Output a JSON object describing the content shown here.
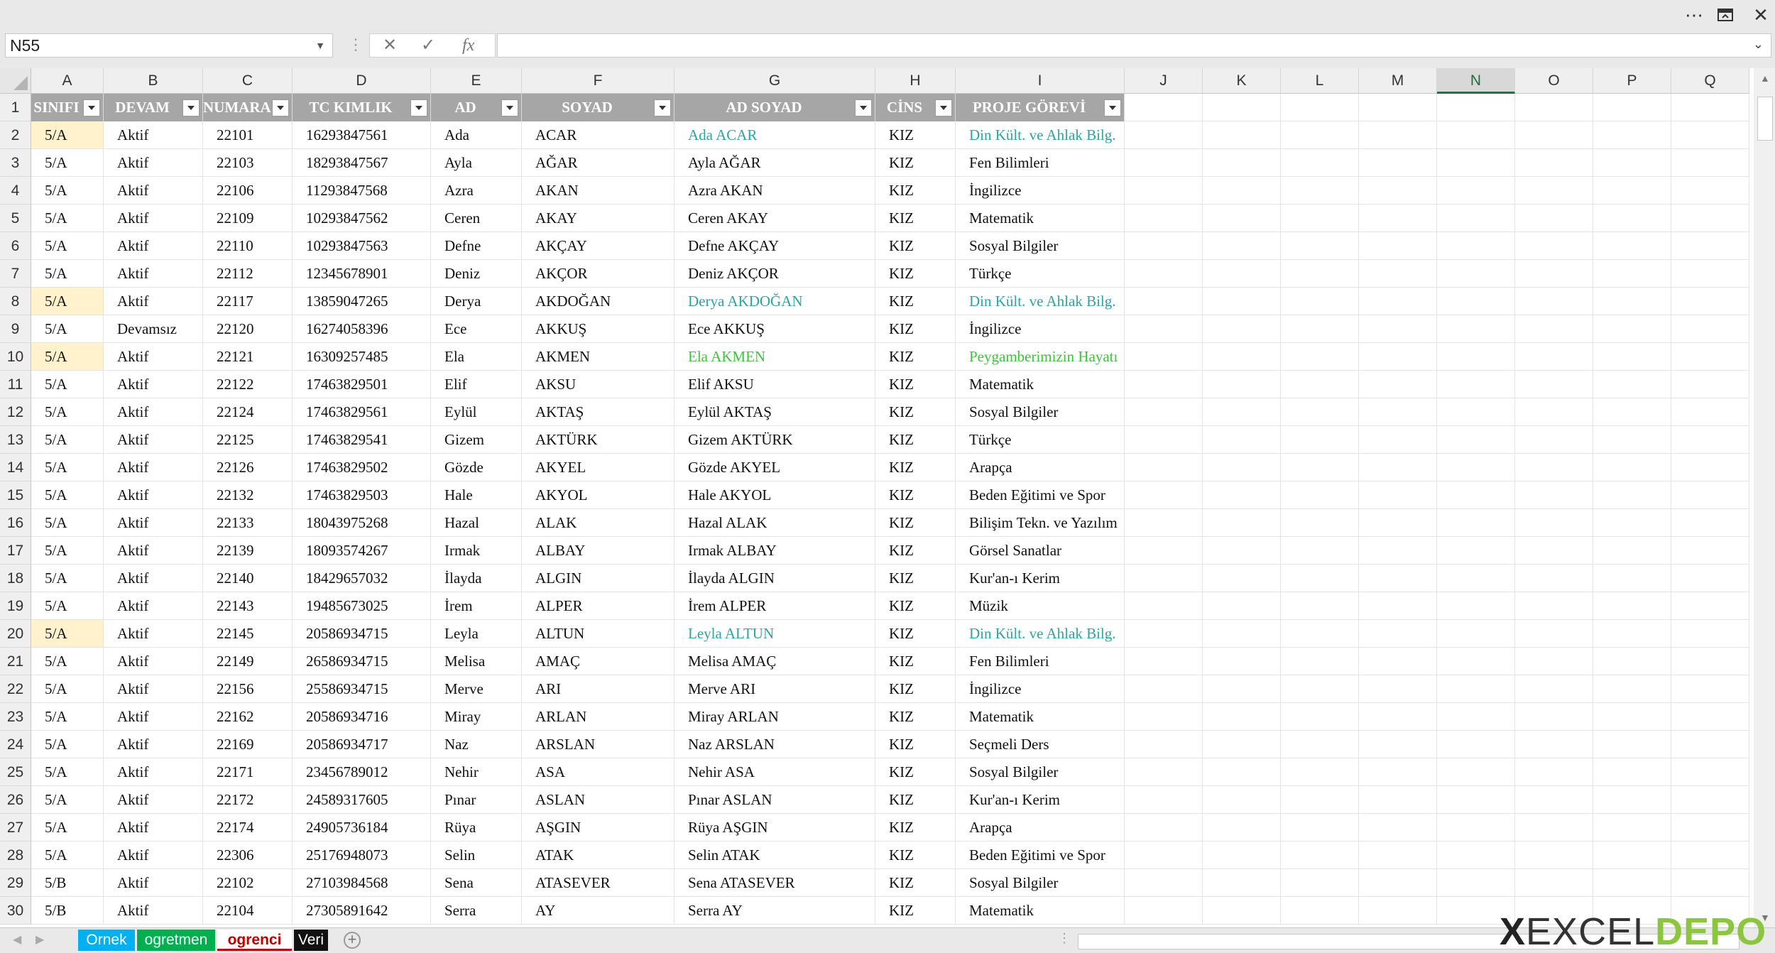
{
  "window": {
    "more_icon": "ellipsis-icon",
    "restore_icon": "restore-icon",
    "close_icon": "close-icon"
  },
  "formula_bar": {
    "name_box": "N55",
    "fx_label": "fx",
    "cancel_glyph": "✕",
    "enter_glyph": "✓",
    "formula": ""
  },
  "columns": [
    "A",
    "B",
    "C",
    "D",
    "E",
    "F",
    "G",
    "H",
    "I",
    "J",
    "K",
    "L",
    "M",
    "N",
    "O",
    "P",
    "Q"
  ],
  "selected_column": "N",
  "headers": [
    "SINIFI",
    "DEVAM",
    "NUMARA",
    "TC KIMLIK",
    "AD",
    "SOYAD",
    "AD SOYAD",
    "CİNS",
    "PROJE GÖREVİ"
  ],
  "rows": [
    [
      "5/A",
      "Aktif",
      "22101",
      "16293847561",
      "Ada",
      "ACAR",
      "Ada ACAR",
      "KIZ",
      "Din Kült. ve Ahlak Bilg."
    ],
    [
      "5/A",
      "Aktif",
      "22103",
      "18293847567",
      "Ayla",
      "AĞAR",
      "Ayla AĞAR",
      "KIZ",
      "Fen Bilimleri"
    ],
    [
      "5/A",
      "Aktif",
      "22106",
      "11293847568",
      "Azra",
      "AKAN",
      "Azra AKAN",
      "KIZ",
      "İngilizce"
    ],
    [
      "5/A",
      "Aktif",
      "22109",
      "10293847562",
      "Ceren",
      "AKAY",
      "Ceren AKAY",
      "KIZ",
      "Matematik"
    ],
    [
      "5/A",
      "Aktif",
      "22110",
      "10293847563",
      "Defne",
      "AKÇAY",
      "Defne AKÇAY",
      "KIZ",
      "Sosyal Bilgiler"
    ],
    [
      "5/A",
      "Aktif",
      "22112",
      "12345678901",
      "Deniz",
      "AKÇOR",
      "Deniz AKÇOR",
      "KIZ",
      "Türkçe"
    ],
    [
      "5/A",
      "Aktif",
      "22117",
      "13859047265",
      "Derya",
      "AKDOĞAN",
      "Derya AKDOĞAN",
      "KIZ",
      "Din Kült. ve Ahlak Bilg."
    ],
    [
      "5/A",
      "Devamsız",
      "22120",
      "16274058396",
      "Ece",
      "AKKUŞ",
      "Ece AKKUŞ",
      "KIZ",
      "İngilizce"
    ],
    [
      "5/A",
      "Aktif",
      "22121",
      "16309257485",
      "Ela",
      "AKMEN",
      "Ela AKMEN",
      "KIZ",
      "Peygamberimizin Hayatı"
    ],
    [
      "5/A",
      "Aktif",
      "22122",
      "17463829501",
      "Elif",
      "AKSU",
      "Elif AKSU",
      "KIZ",
      "Matematik"
    ],
    [
      "5/A",
      "Aktif",
      "22124",
      "17463829561",
      "Eylül",
      "AKTAŞ",
      "Eylül AKTAŞ",
      "KIZ",
      "Sosyal Bilgiler"
    ],
    [
      "5/A",
      "Aktif",
      "22125",
      "17463829541",
      "Gizem",
      "AKTÜRK",
      "Gizem AKTÜRK",
      "KIZ",
      "Türkçe"
    ],
    [
      "5/A",
      "Aktif",
      "22126",
      "17463829502",
      "Gözde",
      "AKYEL",
      "Gözde AKYEL",
      "KIZ",
      "Arapça"
    ],
    [
      "5/A",
      "Aktif",
      "22132",
      "17463829503",
      "Hale",
      "AKYOL",
      "Hale AKYOL",
      "KIZ",
      "Beden Eğitimi ve Spor"
    ],
    [
      "5/A",
      "Aktif",
      "22133",
      "18043975268",
      "Hazal",
      "ALAK",
      "Hazal ALAK",
      "KIZ",
      "Bilişim Tekn. ve Yazılım"
    ],
    [
      "5/A",
      "Aktif",
      "22139",
      "18093574267",
      "Irmak",
      "ALBAY",
      "Irmak ALBAY",
      "KIZ",
      "Görsel Sanatlar"
    ],
    [
      "5/A",
      "Aktif",
      "22140",
      "18429657032",
      "İlayda",
      "ALGIN",
      "İlayda ALGIN",
      "KIZ",
      "Kur'an-ı Kerim"
    ],
    [
      "5/A",
      "Aktif",
      "22143",
      "19485673025",
      "İrem",
      "ALPER",
      "İrem ALPER",
      "KIZ",
      "Müzik"
    ],
    [
      "5/A",
      "Aktif",
      "22145",
      "20586934715",
      "Leyla",
      "ALTUN",
      "Leyla ALTUN",
      "KIZ",
      "Din Kült. ve Ahlak Bilg."
    ],
    [
      "5/A",
      "Aktif",
      "22149",
      "26586934715",
      "Melisa",
      "AMAÇ",
      "Melisa AMAÇ",
      "KIZ",
      "Fen Bilimleri"
    ],
    [
      "5/A",
      "Aktif",
      "22156",
      "25586934715",
      "Merve",
      "ARI",
      "Merve ARI",
      "KIZ",
      "İngilizce"
    ],
    [
      "5/A",
      "Aktif",
      "22162",
      "20586934716",
      "Miray",
      "ARLAN",
      "Miray ARLAN",
      "KIZ",
      "Matematik"
    ],
    [
      "5/A",
      "Aktif",
      "22169",
      "20586934717",
      "Naz",
      "ARSLAN",
      "Naz ARSLAN",
      "KIZ",
      "Seçmeli Ders"
    ],
    [
      "5/A",
      "Aktif",
      "22171",
      "23456789012",
      "Nehir",
      "ASA",
      "Nehir ASA",
      "KIZ",
      "Sosyal Bilgiler"
    ],
    [
      "5/A",
      "Aktif",
      "22172",
      "24589317605",
      "Pınar",
      "ASLAN",
      "Pınar ASLAN",
      "KIZ",
      "Kur'an-ı Kerim"
    ],
    [
      "5/A",
      "Aktif",
      "22174",
      "24905736184",
      "Rüya",
      "AŞGIN",
      "Rüya AŞGIN",
      "KIZ",
      "Arapça"
    ],
    [
      "5/A",
      "Aktif",
      "22306",
      "25176948073",
      "Selin",
      "ATAK",
      "Selin ATAK",
      "KIZ",
      "Beden Eğitimi ve Spor"
    ],
    [
      "5/B",
      "Aktif",
      "22102",
      "27103984568",
      "Sena",
      "ATASEVER",
      "Sena ATASEVER",
      "KIZ",
      "Sosyal Bilgiler"
    ],
    [
      "5/B",
      "Aktif",
      "22104",
      "27305891642",
      "Serra",
      "AY",
      "Serra AY",
      "KIZ",
      "Matematik"
    ]
  ],
  "highlights": {
    "1": "teal",
    "7": "teal",
    "9": "green",
    "19": "teal"
  },
  "colors": {
    "teal": "#2aa5a0",
    "green": "#3cc43c",
    "highlight_fill": "#fff2cc",
    "header_fill": "#a6a6a6",
    "selected_header": "#217346"
  },
  "sheet_tabs": [
    {
      "label": "Ornek",
      "bg": "#00b0f0",
      "fg": "#ffffff",
      "active": false
    },
    {
      "label": "ogretmen",
      "bg": "#00b050",
      "fg": "#ffffff",
      "active": false
    },
    {
      "label": "ogrenci",
      "bg": "#ffffff",
      "fg": "#c00000",
      "active": true
    },
    {
      "label": "Veri",
      "bg": "#111111",
      "fg": "#ffffff",
      "active": false
    }
  ],
  "logo": {
    "x": "X",
    "excel": "EXCEL",
    "depo": "DEPO"
  }
}
